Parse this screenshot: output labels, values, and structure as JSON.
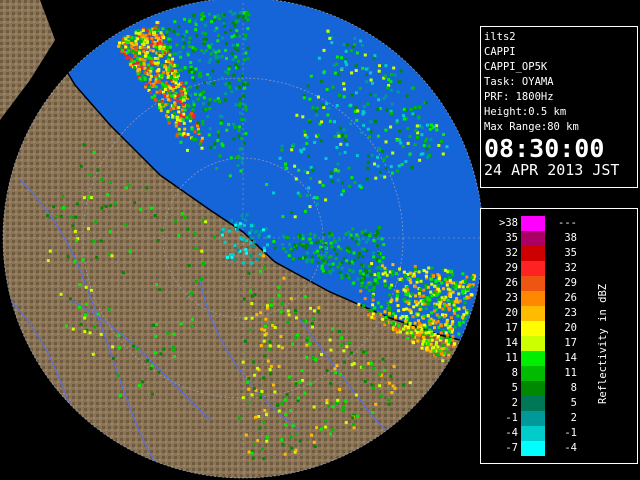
{
  "colors": {
    "background": "#000000",
    "radar_field": "#1565D8",
    "terrain": "#8B7556",
    "terrain_dark": "#4E3D2A",
    "coastline": "#000000",
    "river": "#5B6EE0",
    "range_ring": "#9AA0B0"
  },
  "info": {
    "site": "ilts2",
    "product": "CAPPI",
    "product_code": "CAPPI_OP5K",
    "task": "Task: OYAMA",
    "prf": "PRF: 1800Hz",
    "height": "Height:0.5 km",
    "max_range": "Max Range:80 km",
    "time": "08:30:00",
    "date": "24 APR 2013 JST"
  },
  "legend": {
    "unit": "Reflectivity in dBZ",
    "rows": [
      {
        "low": ">38",
        "high": "---",
        "color": "#FF00FF"
      },
      {
        "low": "35",
        "high": "38",
        "color": "#AA0066"
      },
      {
        "low": "32",
        "high": "35",
        "color": "#CC0000"
      },
      {
        "low": "29",
        "high": "32",
        "color": "#FF2222"
      },
      {
        "low": "26",
        "high": "29",
        "color": "#EE5511"
      },
      {
        "low": "23",
        "high": "26",
        "color": "#FF8800"
      },
      {
        "low": "20",
        "high": "23",
        "color": "#FFBB00"
      },
      {
        "low": "17",
        "high": "20",
        "color": "#FFFF00"
      },
      {
        "low": "14",
        "high": "17",
        "color": "#CCFF00"
      },
      {
        "low": "11",
        "high": "14",
        "color": "#00EE00"
      },
      {
        "low": "8",
        "high": "11",
        "color": "#00BB00"
      },
      {
        "low": "5",
        "high": "8",
        "color": "#008800"
      },
      {
        "low": "2",
        "high": "5",
        "color": "#007755"
      },
      {
        "low": "-1",
        "high": "2",
        "color": "#009999"
      },
      {
        "low": "-4",
        "high": "-1",
        "color": "#00CCCC"
      },
      {
        "low": "-7",
        "high": "-4",
        "color": "#00FFFF"
      }
    ]
  }
}
